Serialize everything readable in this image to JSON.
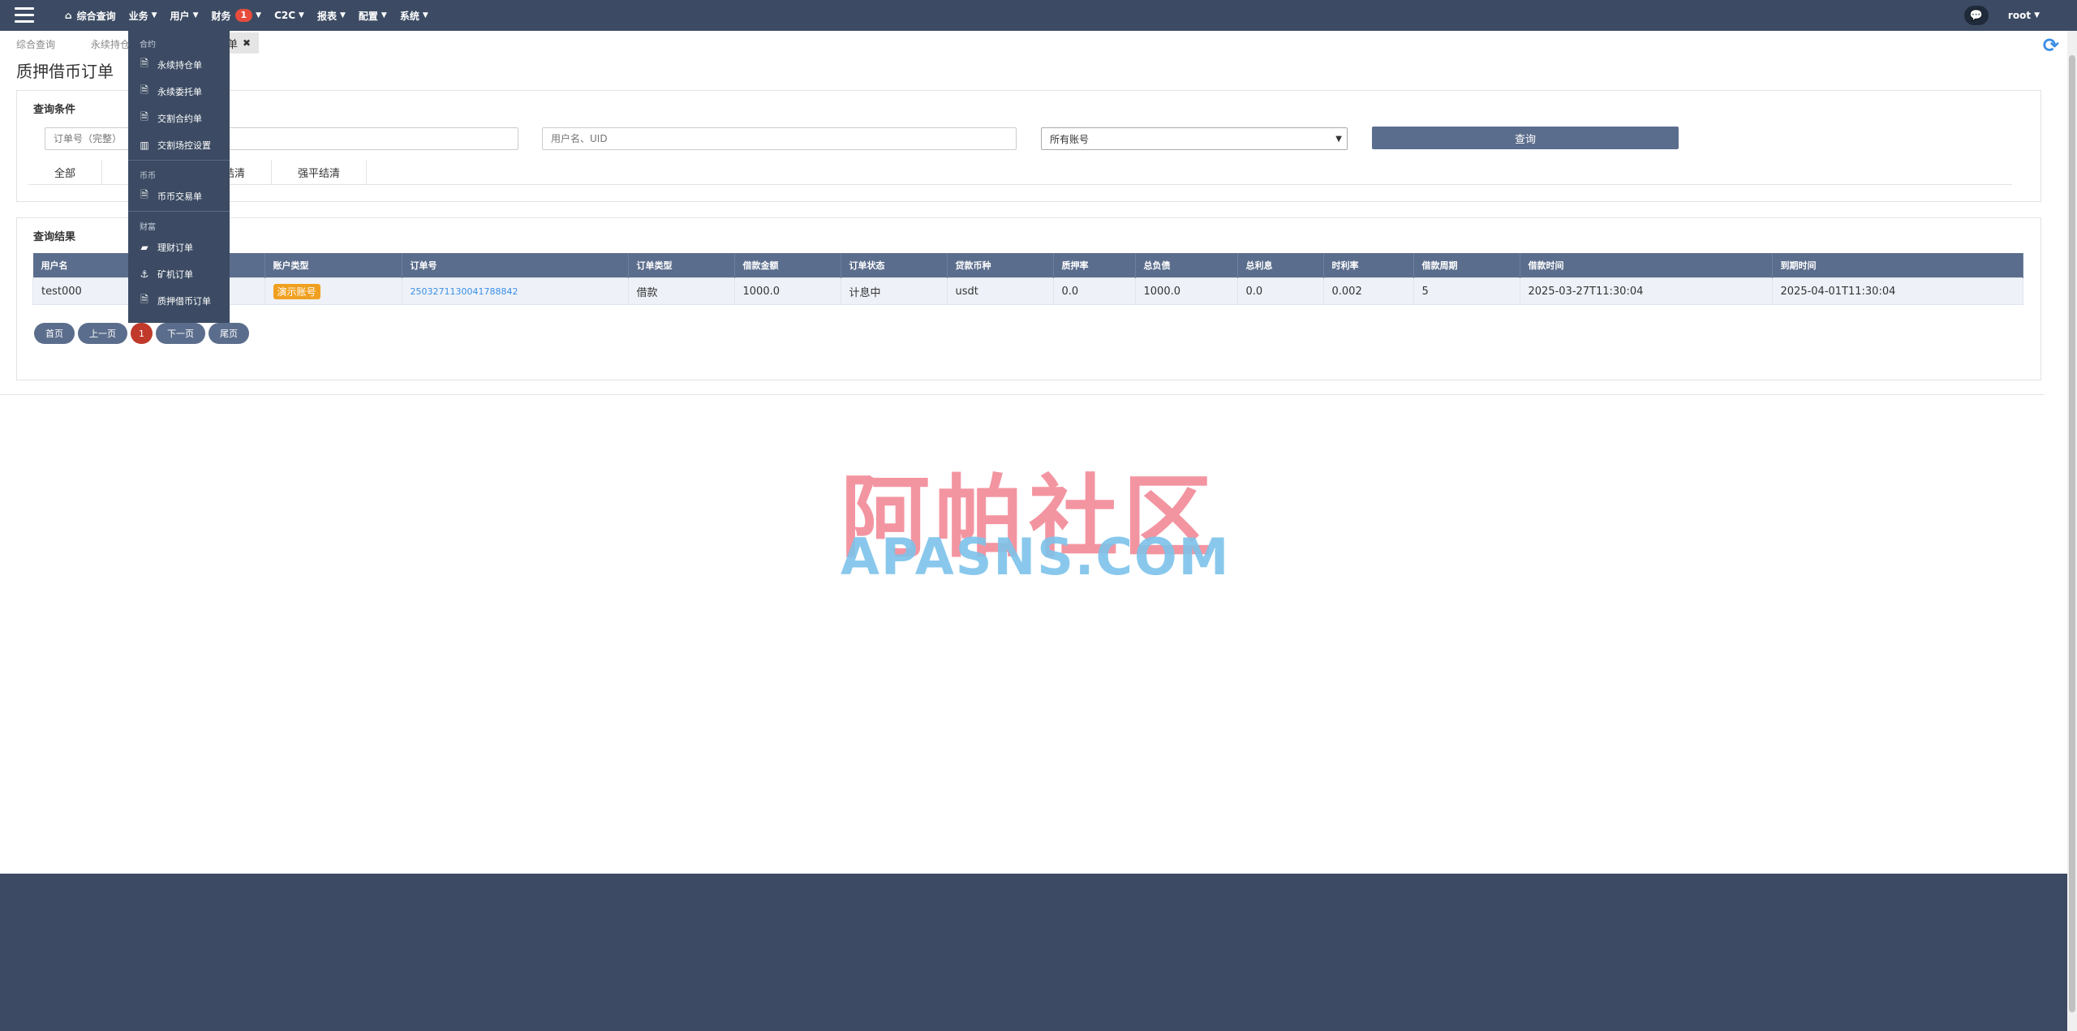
{
  "topbar": {
    "nav": [
      {
        "label": "综合查询",
        "has_home": true
      },
      {
        "label": "业务",
        "caret": true
      },
      {
        "label": "用户",
        "caret": true
      },
      {
        "label": "财务",
        "caret": true,
        "badge": "1"
      },
      {
        "label": "C2C",
        "caret": true
      },
      {
        "label": "报表",
        "caret": true
      },
      {
        "label": "配置",
        "caret": true
      },
      {
        "label": "系统",
        "caret": true
      }
    ],
    "user": "root"
  },
  "breadcrumbs": [
    "综合查询",
    "永续持仓"
  ],
  "active_tab": "单",
  "page_title": "质押借币订单",
  "query": {
    "title": "查询条件",
    "order_placeholder": "订单号（完整）",
    "user_placeholder": "用户名、UID",
    "account_select": "所有账号",
    "button": "查询",
    "tabs": [
      "全部",
      "",
      "还结清",
      "强平结清"
    ]
  },
  "result": {
    "title": "查询结果",
    "columns": [
      "用户名",
      "",
      "账户类型",
      "订单号",
      "订单类型",
      "借款金额",
      "订单状态",
      "贷款币种",
      "质押率",
      "总负债",
      "总利息",
      "时利率",
      "借款周期",
      "借款时间",
      "到期时间"
    ],
    "rows": [
      {
        "username": "test000",
        "uid": "",
        "account_type": "演示账号",
        "order_no": "2503271130041788842",
        "order_type": "借款",
        "amount": "1000.0",
        "status": "计息中",
        "currency": "usdt",
        "pledge_rate": "0.0",
        "total_debt": "1000.0",
        "total_interest": "0.0",
        "hourly_rate": "0.002",
        "period": "5",
        "borrow_time": "2025-03-27T11:30:04",
        "due_time": "2025-04-01T11:30:04"
      }
    ]
  },
  "pager": {
    "first": "首页",
    "prev": "上一页",
    "current": "1",
    "next": "下一页",
    "last": "尾页"
  },
  "watermark": {
    "cn": "阿帕社区",
    "en": "APASNS.COM"
  },
  "dropdown": {
    "groups": [
      {
        "title": "合约",
        "items": [
          {
            "label": "永续持仓单",
            "icon": "doc-icon"
          },
          {
            "label": "永续委托单",
            "icon": "doc-icon"
          },
          {
            "label": "交割合约单",
            "icon": "doc-icon"
          },
          {
            "label": "交割场控设置",
            "icon": "table-icon"
          }
        ]
      },
      {
        "title": "币币",
        "items": [
          {
            "label": "币币交易单",
            "icon": "doc-icon"
          }
        ]
      },
      {
        "title": "财富",
        "items": [
          {
            "label": "理财订单",
            "icon": "folder-icon"
          },
          {
            "label": "矿机订单",
            "icon": "anchor-icon"
          },
          {
            "label": "质押借币订单",
            "icon": "doc-icon"
          }
        ]
      }
    ]
  }
}
